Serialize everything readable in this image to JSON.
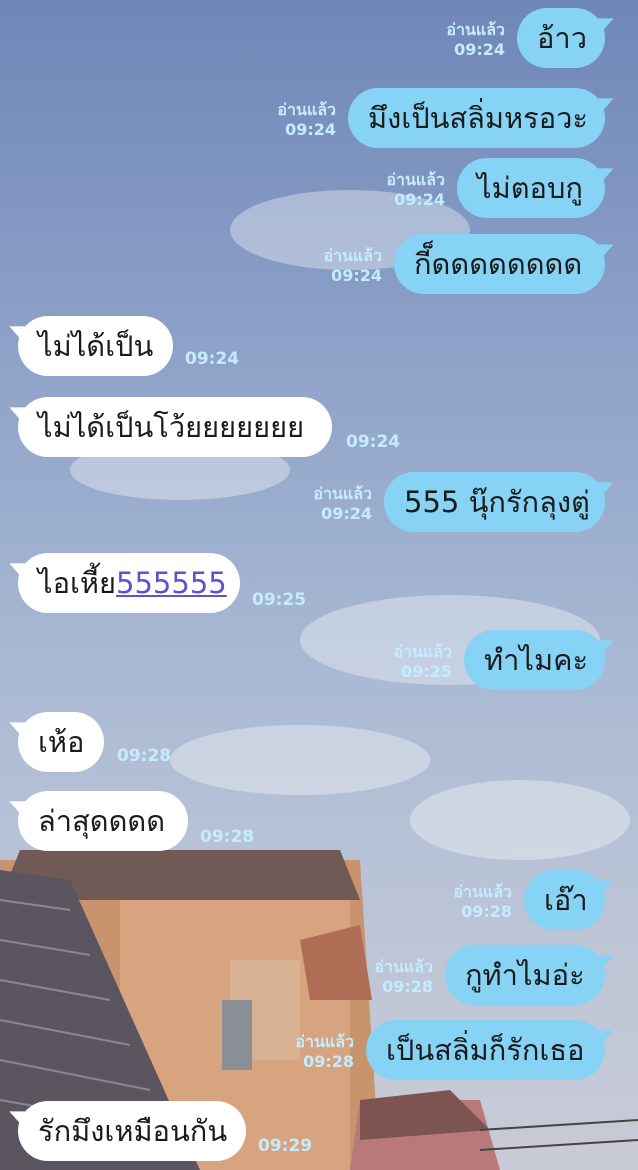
{
  "messages": [
    {
      "side": "out",
      "text": "อ้าว",
      "read": "อ่านแล้ว",
      "time": "09:24"
    },
    {
      "side": "out",
      "text": "มึงเป็นสลิ่มหรอวะ",
      "read": "อ่านแล้ว",
      "time": "09:24"
    },
    {
      "side": "out",
      "text": "ไม่ตอบกู",
      "read": "อ่านแล้ว",
      "time": "09:24"
    },
    {
      "side": "out",
      "text": "กี็ดดดดดดดด",
      "read": "อ่านแล้ว",
      "time": "09:24"
    },
    {
      "side": "in",
      "text": "ไม่ได้เป็น",
      "time": "09:24"
    },
    {
      "side": "in",
      "text": "ไม่ได้เป็นโว้ยยยยยยย",
      "time": "09:24"
    },
    {
      "side": "out",
      "text": "555 นุ๊กรักลุงตู่",
      "read": "อ่านแล้ว",
      "time": "09:24"
    },
    {
      "side": "in",
      "text_prefix": "ไอเหี้ย",
      "link_text": "555555",
      "time": "09:25"
    },
    {
      "side": "out",
      "text": "ทำไมคะ",
      "read": "อ่านแล้ว",
      "time": "09:25"
    },
    {
      "side": "in",
      "text": "เห้อ",
      "time": "09:28"
    },
    {
      "side": "in",
      "text": "ล่าสุดดดด",
      "time": "09:28"
    },
    {
      "side": "out",
      "text": "เอ๊า",
      "read": "อ่านแล้ว",
      "time": "09:28"
    },
    {
      "side": "out",
      "text": "กูทำไมอ่ะ",
      "read": "อ่านแล้ว",
      "time": "09:28"
    },
    {
      "side": "out",
      "text": "เป็นสลิ่มก็รักเธอ",
      "read": "อ่านแล้ว",
      "time": "09:28"
    },
    {
      "side": "in",
      "text": "รักมึงเหมือนกัน",
      "time": "09:29"
    }
  ],
  "colors": {
    "outgoing_bubble": "#86d3f5",
    "incoming_bubble": "#ffffff",
    "meta_text": "#c4ecff",
    "link": "#5a55c8"
  }
}
